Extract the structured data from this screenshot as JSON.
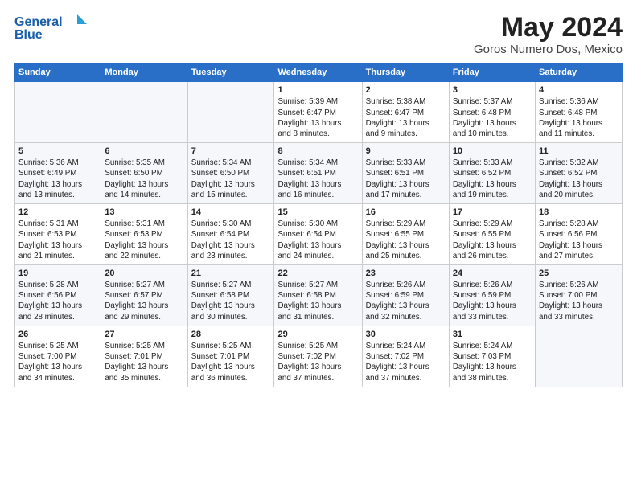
{
  "header": {
    "logo_line1": "General",
    "logo_line2": "Blue",
    "month": "May 2024",
    "location": "Goros Numero Dos, Mexico"
  },
  "weekdays": [
    "Sunday",
    "Monday",
    "Tuesday",
    "Wednesday",
    "Thursday",
    "Friday",
    "Saturday"
  ],
  "weeks": [
    [
      {
        "day": "",
        "info": ""
      },
      {
        "day": "",
        "info": ""
      },
      {
        "day": "",
        "info": ""
      },
      {
        "day": "1",
        "info": "Sunrise: 5:39 AM\nSunset: 6:47 PM\nDaylight: 13 hours\nand 8 minutes."
      },
      {
        "day": "2",
        "info": "Sunrise: 5:38 AM\nSunset: 6:47 PM\nDaylight: 13 hours\nand 9 minutes."
      },
      {
        "day": "3",
        "info": "Sunrise: 5:37 AM\nSunset: 6:48 PM\nDaylight: 13 hours\nand 10 minutes."
      },
      {
        "day": "4",
        "info": "Sunrise: 5:36 AM\nSunset: 6:48 PM\nDaylight: 13 hours\nand 11 minutes."
      }
    ],
    [
      {
        "day": "5",
        "info": "Sunrise: 5:36 AM\nSunset: 6:49 PM\nDaylight: 13 hours\nand 13 minutes."
      },
      {
        "day": "6",
        "info": "Sunrise: 5:35 AM\nSunset: 6:50 PM\nDaylight: 13 hours\nand 14 minutes."
      },
      {
        "day": "7",
        "info": "Sunrise: 5:34 AM\nSunset: 6:50 PM\nDaylight: 13 hours\nand 15 minutes."
      },
      {
        "day": "8",
        "info": "Sunrise: 5:34 AM\nSunset: 6:51 PM\nDaylight: 13 hours\nand 16 minutes."
      },
      {
        "day": "9",
        "info": "Sunrise: 5:33 AM\nSunset: 6:51 PM\nDaylight: 13 hours\nand 17 minutes."
      },
      {
        "day": "10",
        "info": "Sunrise: 5:33 AM\nSunset: 6:52 PM\nDaylight: 13 hours\nand 19 minutes."
      },
      {
        "day": "11",
        "info": "Sunrise: 5:32 AM\nSunset: 6:52 PM\nDaylight: 13 hours\nand 20 minutes."
      }
    ],
    [
      {
        "day": "12",
        "info": "Sunrise: 5:31 AM\nSunset: 6:53 PM\nDaylight: 13 hours\nand 21 minutes."
      },
      {
        "day": "13",
        "info": "Sunrise: 5:31 AM\nSunset: 6:53 PM\nDaylight: 13 hours\nand 22 minutes."
      },
      {
        "day": "14",
        "info": "Sunrise: 5:30 AM\nSunset: 6:54 PM\nDaylight: 13 hours\nand 23 minutes."
      },
      {
        "day": "15",
        "info": "Sunrise: 5:30 AM\nSunset: 6:54 PM\nDaylight: 13 hours\nand 24 minutes."
      },
      {
        "day": "16",
        "info": "Sunrise: 5:29 AM\nSunset: 6:55 PM\nDaylight: 13 hours\nand 25 minutes."
      },
      {
        "day": "17",
        "info": "Sunrise: 5:29 AM\nSunset: 6:55 PM\nDaylight: 13 hours\nand 26 minutes."
      },
      {
        "day": "18",
        "info": "Sunrise: 5:28 AM\nSunset: 6:56 PM\nDaylight: 13 hours\nand 27 minutes."
      }
    ],
    [
      {
        "day": "19",
        "info": "Sunrise: 5:28 AM\nSunset: 6:56 PM\nDaylight: 13 hours\nand 28 minutes."
      },
      {
        "day": "20",
        "info": "Sunrise: 5:27 AM\nSunset: 6:57 PM\nDaylight: 13 hours\nand 29 minutes."
      },
      {
        "day": "21",
        "info": "Sunrise: 5:27 AM\nSunset: 6:58 PM\nDaylight: 13 hours\nand 30 minutes."
      },
      {
        "day": "22",
        "info": "Sunrise: 5:27 AM\nSunset: 6:58 PM\nDaylight: 13 hours\nand 31 minutes."
      },
      {
        "day": "23",
        "info": "Sunrise: 5:26 AM\nSunset: 6:59 PM\nDaylight: 13 hours\nand 32 minutes."
      },
      {
        "day": "24",
        "info": "Sunrise: 5:26 AM\nSunset: 6:59 PM\nDaylight: 13 hours\nand 33 minutes."
      },
      {
        "day": "25",
        "info": "Sunrise: 5:26 AM\nSunset: 7:00 PM\nDaylight: 13 hours\nand 33 minutes."
      }
    ],
    [
      {
        "day": "26",
        "info": "Sunrise: 5:25 AM\nSunset: 7:00 PM\nDaylight: 13 hours\nand 34 minutes."
      },
      {
        "day": "27",
        "info": "Sunrise: 5:25 AM\nSunset: 7:01 PM\nDaylight: 13 hours\nand 35 minutes."
      },
      {
        "day": "28",
        "info": "Sunrise: 5:25 AM\nSunset: 7:01 PM\nDaylight: 13 hours\nand 36 minutes."
      },
      {
        "day": "29",
        "info": "Sunrise: 5:25 AM\nSunset: 7:02 PM\nDaylight: 13 hours\nand 37 minutes."
      },
      {
        "day": "30",
        "info": "Sunrise: 5:24 AM\nSunset: 7:02 PM\nDaylight: 13 hours\nand 37 minutes."
      },
      {
        "day": "31",
        "info": "Sunrise: 5:24 AM\nSunset: 7:03 PM\nDaylight: 13 hours\nand 38 minutes."
      },
      {
        "day": "",
        "info": ""
      }
    ]
  ]
}
